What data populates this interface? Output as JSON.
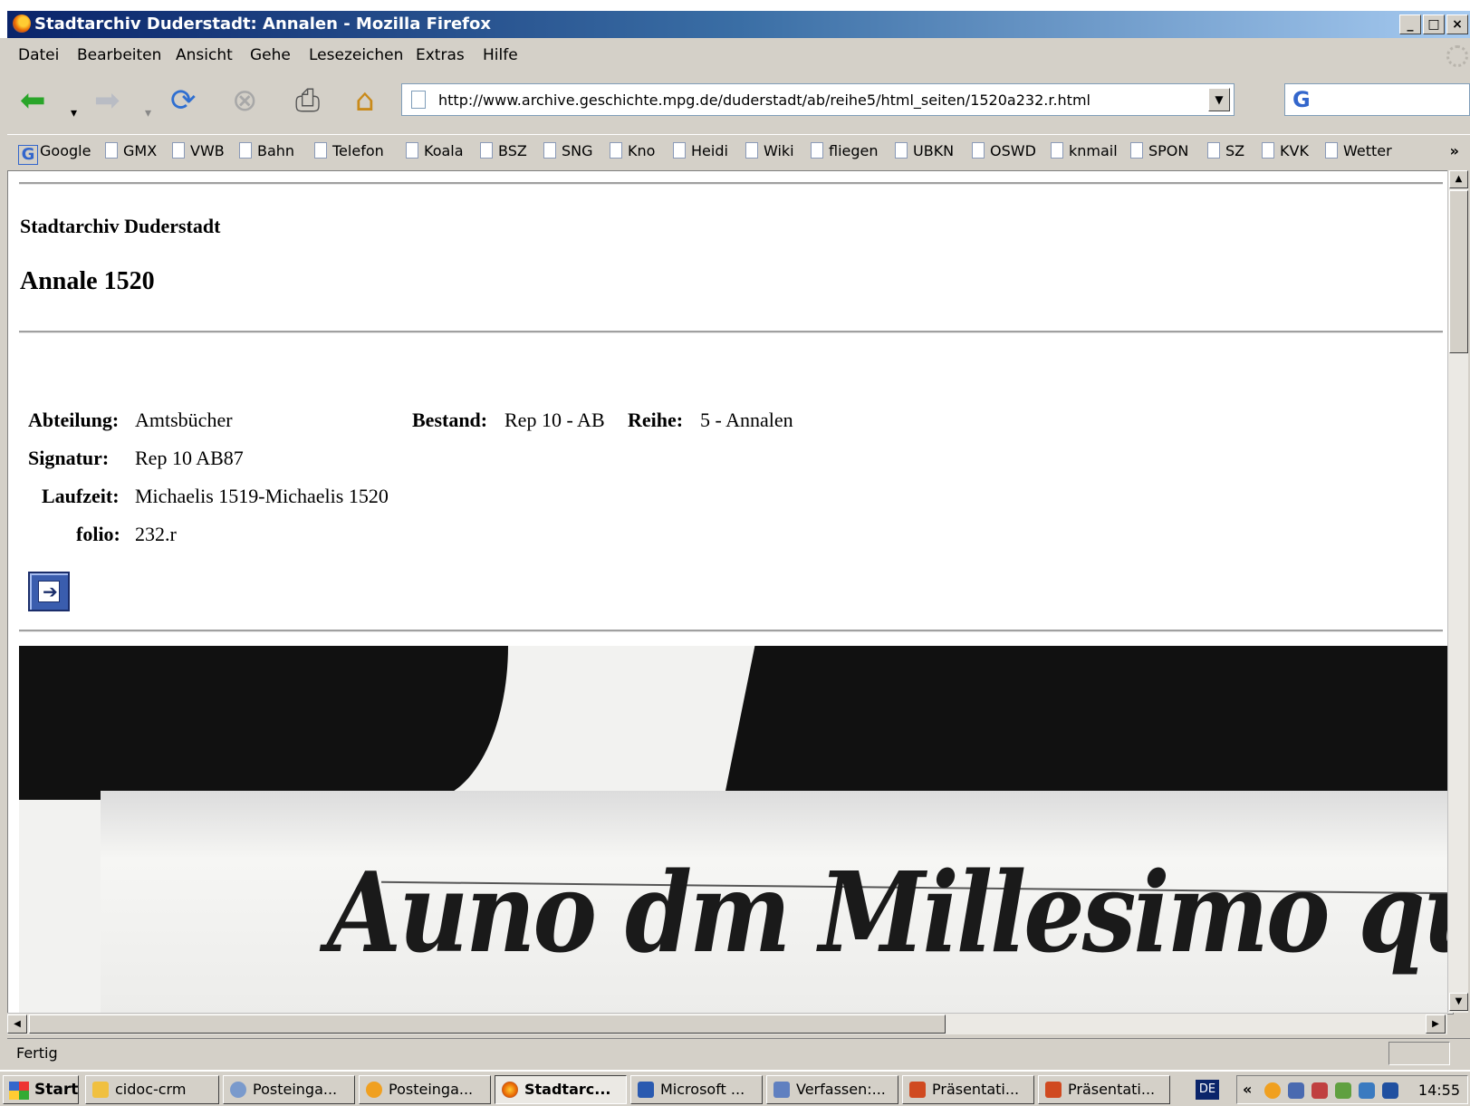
{
  "window": {
    "title": "Stadtarchiv Duderstadt: Annalen - Mozilla Firefox",
    "minimize": "_",
    "maximize": "□",
    "close": "×"
  },
  "menu": [
    "Datei",
    "Bearbeiten",
    "Ansicht",
    "Gehe",
    "Lesezeichen",
    "Extras",
    "Hilfe"
  ],
  "nav": {
    "url": "http://www.archive.geschichte.mpg.de/duderstadt/ab/reihe5/html_seiten/1520a232.r.html",
    "search_logo": "G"
  },
  "bookmarks": [
    "Google",
    "GMX",
    "VWB",
    "Bahn",
    "Telefon",
    "Koala",
    "BSZ",
    "SNG",
    "Kno",
    "Heidi",
    "Wiki",
    "fliegen",
    "UBKN",
    "OSWD",
    "knmail",
    "SPON",
    "SZ",
    "KVK",
    "Wetter"
  ],
  "bookmarks_more": "»",
  "page": {
    "archive_name": "Stadtarchiv Duderstadt",
    "title": "Annale 1520",
    "meta": {
      "abteilung_label": "Abteilung:",
      "abteilung": "Amtsbücher",
      "bestand_label": "Bestand:",
      "bestand": "Rep 10 - AB",
      "reihe_label": "Reihe:",
      "reihe": "5 - Annalen",
      "signatur_label": "Signatur:",
      "signatur": "Rep 10 AB87",
      "laufzeit_label": "Laufzeit:",
      "laufzeit": "Michaelis 1519-Michaelis 1520",
      "folio_label": "folio:",
      "folio": "232.r"
    },
    "scan_text": "Auno dm Millesimo quint"
  },
  "status": {
    "text": "Fertig"
  },
  "taskbar": {
    "start": "Start",
    "tasks": [
      "cidoc-crm",
      "Posteinga...",
      "Posteinga...",
      "Stadtarc...",
      "Microsoft ...",
      "Verfassen:...",
      "Präsentati...",
      "Präsentati..."
    ],
    "lang": "DE",
    "tray_arrows": "«",
    "clock": "14:55"
  },
  "colors": {
    "titlebar": "#0a246a",
    "chrome": "#d4d0c8",
    "link_blue": "#3a5dae"
  }
}
